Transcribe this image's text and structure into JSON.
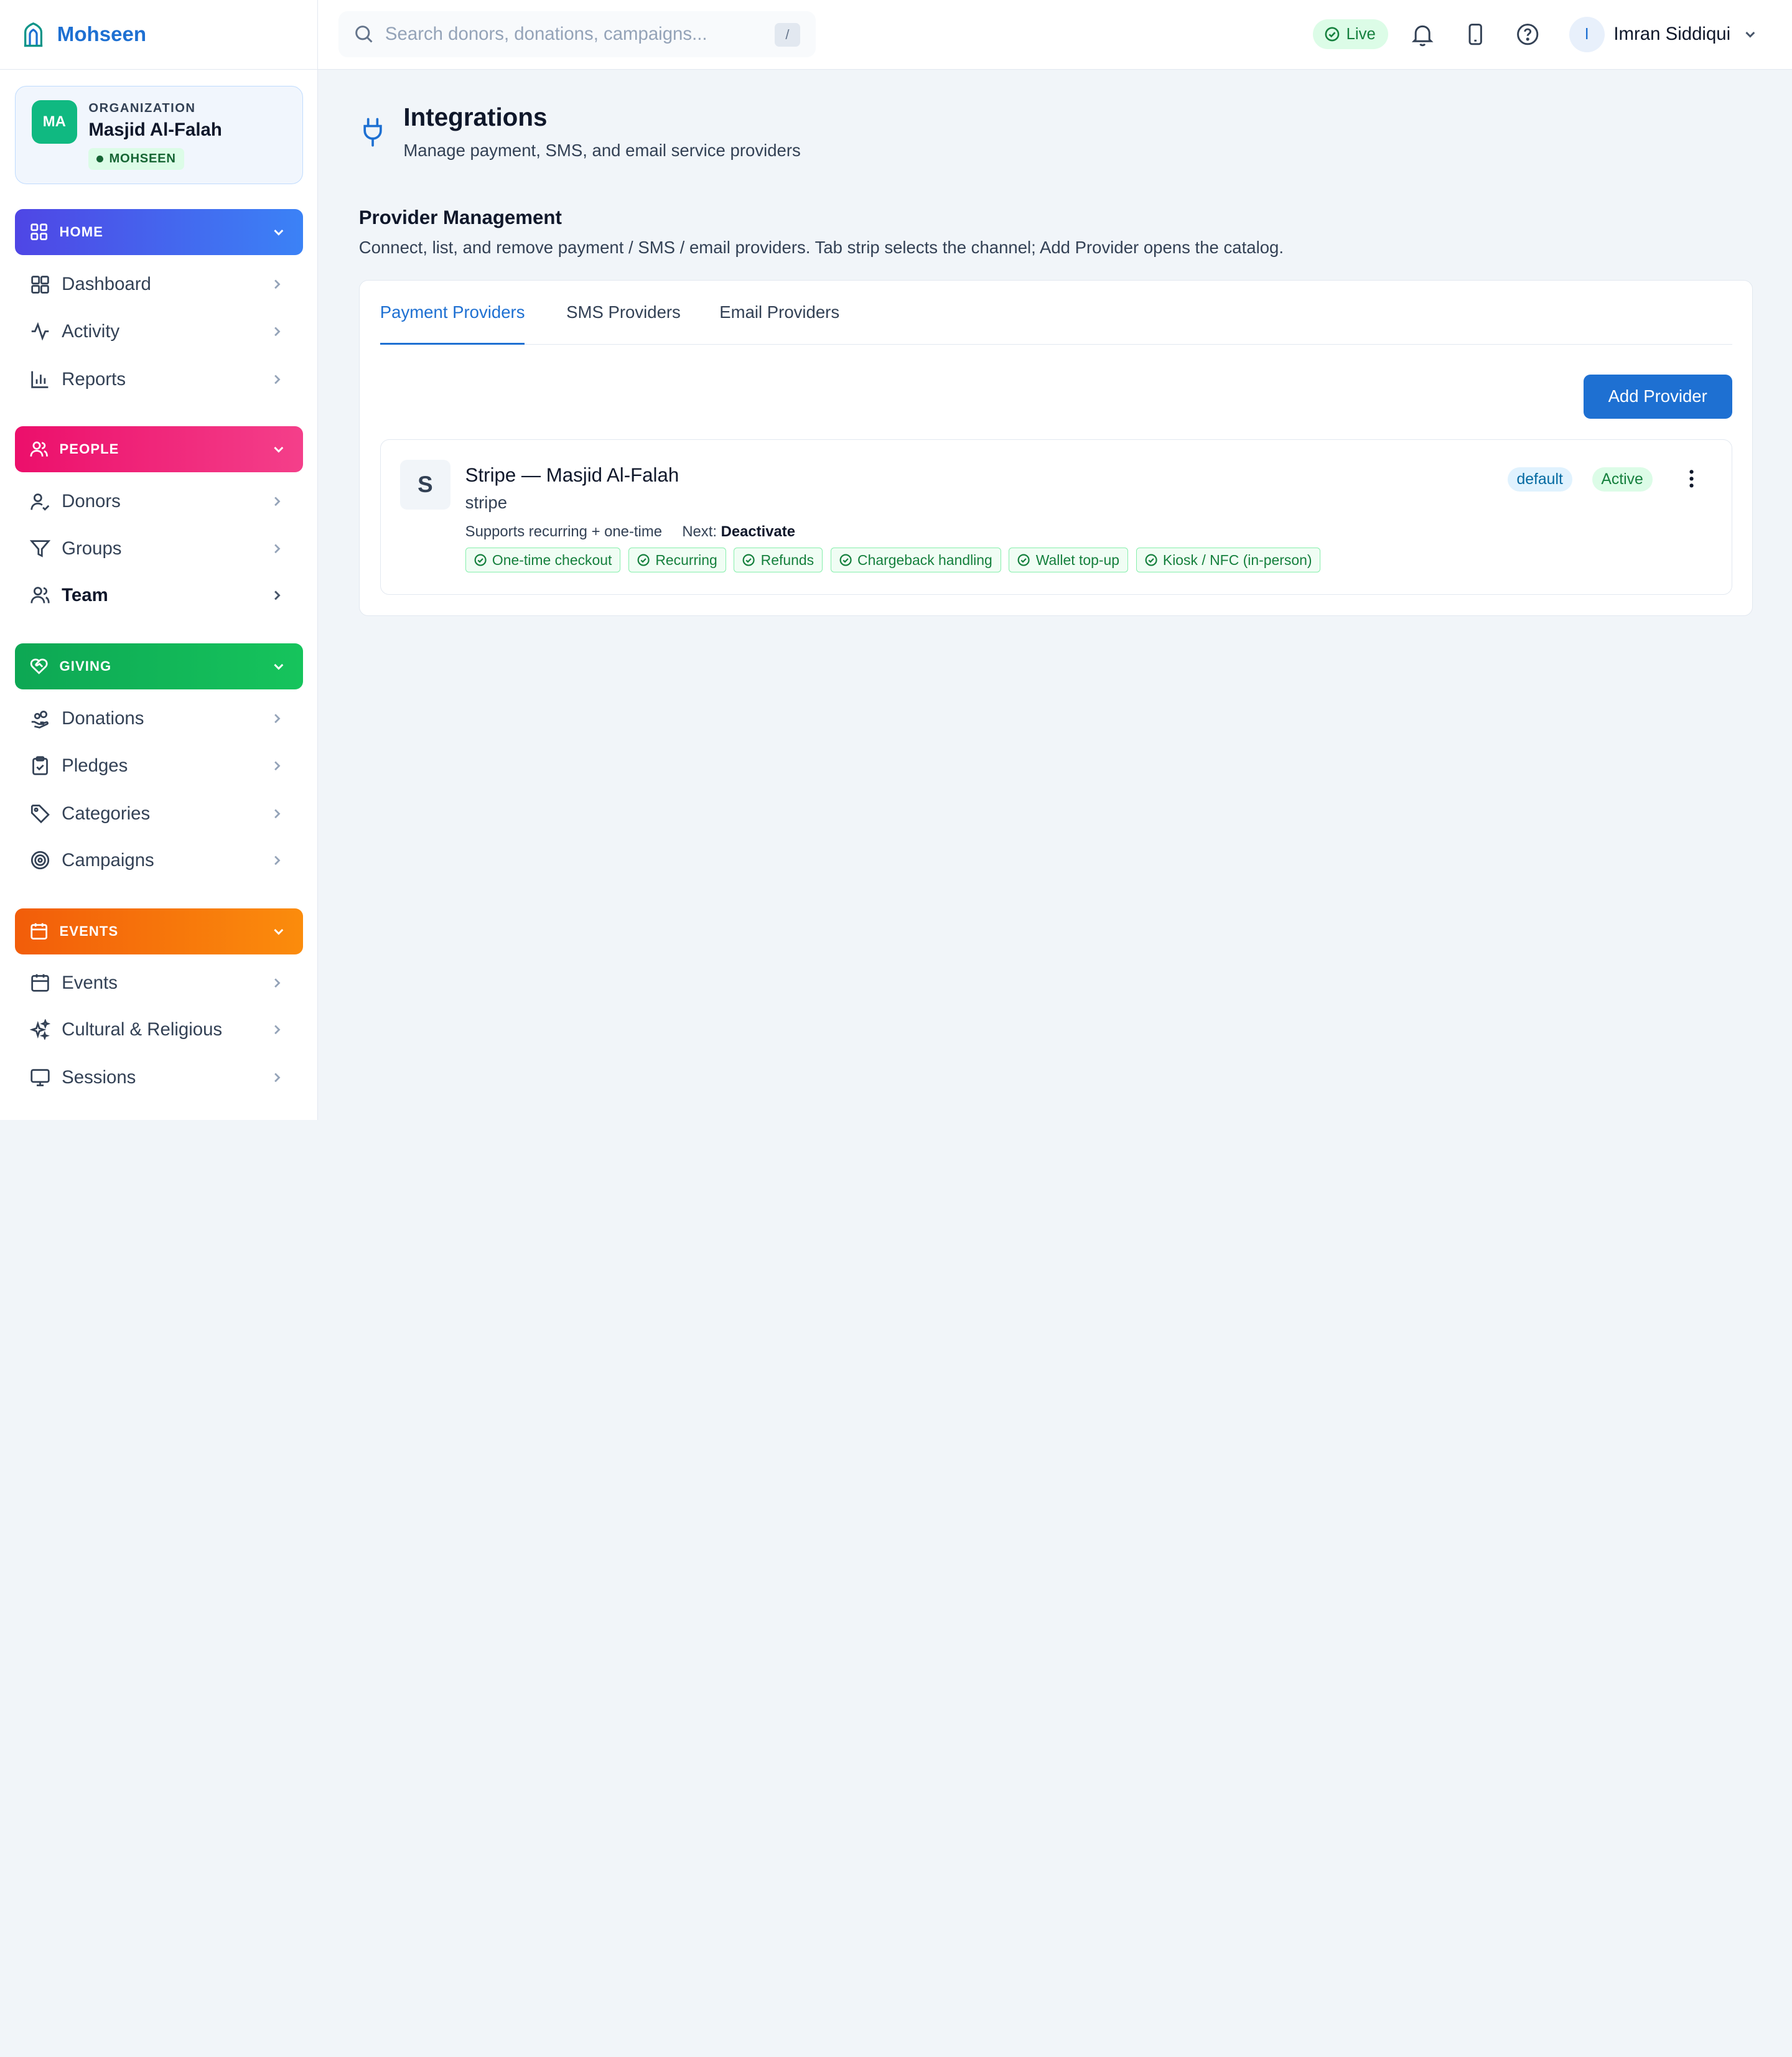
{
  "brand": {
    "name": "Mohseen"
  },
  "org": {
    "initials": "MA",
    "label": "ORGANIZATION",
    "name": "Masjid Al-Falah",
    "tag": "MOHSEEN"
  },
  "sidebar": {
    "sections": [
      {
        "label": "HOME",
        "color": "#4f46e5",
        "items": [
          "Dashboard",
          "Activity",
          "Reports"
        ]
      },
      {
        "label": "PEOPLE",
        "color": "#ec0f6b",
        "items": [
          "Donors",
          "Groups",
          "Team"
        ]
      },
      {
        "label": "GIVING",
        "color": "#0da754",
        "items": [
          "Donations",
          "Pledges",
          "Categories",
          "Campaigns"
        ]
      },
      {
        "label": "EVENTS",
        "color": "#f25d0a",
        "items": [
          "Events",
          "Cultural & Religious",
          "Sessions"
        ]
      }
    ]
  },
  "topbar": {
    "search_placeholder": "Search donors, donations, campaigns...",
    "search_shortcut": "/",
    "live_label": "Live",
    "user_initial": "I",
    "user_name": "Imran Siddiqui"
  },
  "page": {
    "title": "Integrations",
    "subtitle": "Manage payment, SMS, and email service providers",
    "section_title": "Provider Management",
    "section_subtitle": "Connect, list, and remove payment / SMS / email providers. Tab strip selects the channel; Add Provider opens the catalog."
  },
  "tabs": [
    "Payment Providers",
    "SMS Providers",
    "Email Providers"
  ],
  "active_tab": "Payment Providers",
  "add_provider_label": "Add Provider",
  "provider": {
    "logo_letter": "S",
    "name": "Stripe — Masjid Al-Falah",
    "slug": "stripe",
    "supports": "Supports recurring + one-time",
    "next_label": "Next:",
    "next_value": "Deactivate",
    "badge_default": "default",
    "badge_status": "Active",
    "features": [
      "One-time checkout",
      "Recurring",
      "Refunds",
      "Chargeback handling",
      "Wallet top-up",
      "Kiosk / NFC (in-person)"
    ]
  },
  "colors": {
    "accent": "#1e70d2",
    "success": "#15803d"
  }
}
